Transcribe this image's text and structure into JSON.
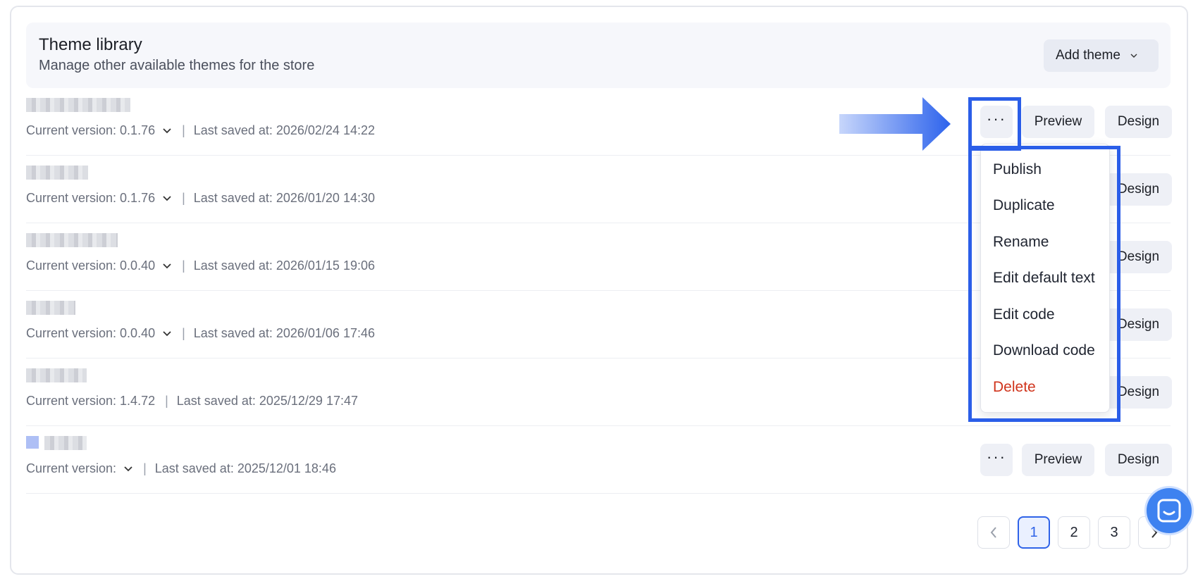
{
  "header": {
    "title": "Theme library",
    "subtitle": "Manage other available themes for the store",
    "add_theme_label": "Add theme"
  },
  "themes": [
    {
      "version_label": "Current version: 0.1.76",
      "saved_label": "Last saved at: 2026/02/24 14:22"
    },
    {
      "version_label": "Current version: 0.1.76",
      "saved_label": "Last saved at: 2026/01/20 14:30"
    },
    {
      "version_label": "Current version: 0.0.40",
      "saved_label": "Last saved at: 2026/01/15 19:06"
    },
    {
      "version_label": "Current version: 0.0.40",
      "saved_label": "Last saved at: 2026/01/06 17:46"
    },
    {
      "version_label": "Current version: 1.4.72",
      "saved_label": "Last saved at: 2025/12/29 17:47"
    },
    {
      "version_label": "Current version:",
      "saved_label": "Last saved at: 2025/12/01 18:46"
    }
  ],
  "actions": {
    "more_label": "···",
    "preview_label": "Preview",
    "design_label": "Design"
  },
  "dropdown": {
    "items": [
      "Publish",
      "Duplicate",
      "Rename",
      "Edit default text",
      "Edit code",
      "Download code",
      "Delete"
    ]
  },
  "pagination": {
    "pages": [
      "1",
      "2",
      "3"
    ],
    "current": "1"
  },
  "colors": {
    "highlight": "#2b5ee8",
    "danger": "#d0341c",
    "accent": "#2f63e8"
  }
}
